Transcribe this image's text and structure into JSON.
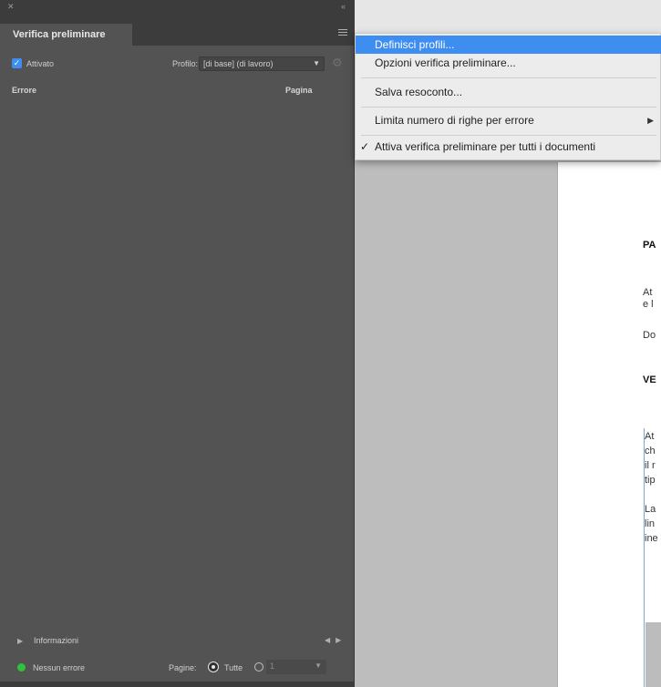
{
  "panel": {
    "title": "Verifica preliminare",
    "enabled_label": "Attivato",
    "enabled": true,
    "profile_label": "Profilo:",
    "profile_value": "[di base] (di lavoro)",
    "columns": {
      "error": "Errore",
      "page": "Pagina"
    },
    "info_label": "Informazioni",
    "status_text": "Nessun errore",
    "pages_label": "Pagine:",
    "pages_all_label": "Tutte",
    "pages_range_value": "1",
    "status_color": "#2fc23a"
  },
  "menu": {
    "items": [
      {
        "label": "Definisci profili...",
        "highlighted": true
      },
      {
        "label": "Opzioni verifica preliminare..."
      },
      {
        "label": "Salva resoconto..."
      },
      {
        "label": "Limita numero di righe per errore",
        "submenu": true
      },
      {
        "label": "Attiva verifica preliminare per tutti i documenti",
        "checked": true
      }
    ],
    "highlight_color": "#3d8ef0"
  },
  "document": {
    "lines": [
      "PA",
      "At",
      "e l",
      "Do",
      "VE",
      "At",
      "ch",
      "il r",
      "tip",
      "La",
      "lin",
      "ine"
    ]
  }
}
